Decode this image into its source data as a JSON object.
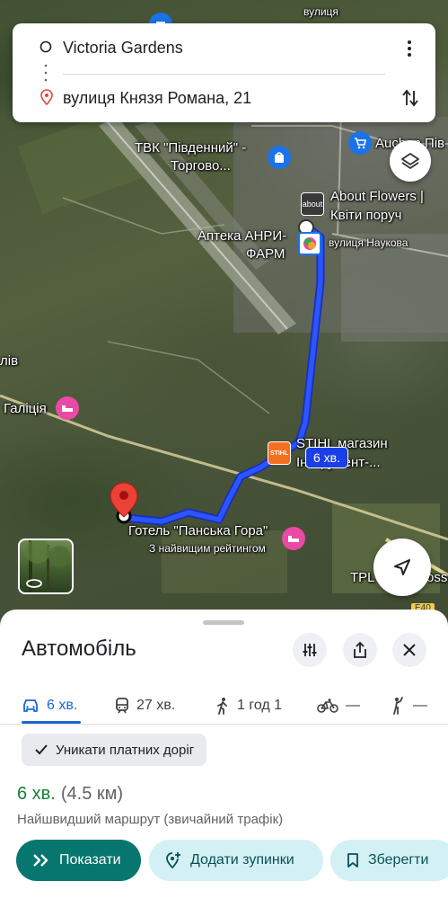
{
  "directions": {
    "origin": "Victoria Gardens",
    "destination": "вулиця Князя Романа, 21"
  },
  "map": {
    "labels": {
      "tvk": "ТВК \"Південний\" -",
      "tvk2": "Торгово...",
      "auchan": "Auchan Пів",
      "about_flowers": "About Flowers |",
      "about_flowers2": "Квіти поруч",
      "pharmacy": "Аптека АНРИ-",
      "pharmacy2": "ФАРМ",
      "street_naukova": "вулиця Наукова",
      "lviv": "лів",
      "galicia": "Галіція",
      "stihl": "STIHL магазин",
      "stihl2": "Інструмент-...",
      "hotel": "Готель \"Панська Гора\"",
      "hotel_rating": "З найвищим рейтингом",
      "tpl": "TPL",
      "ross": "oss",
      "top_label": "вулиця",
      "road_e40": "E40"
    },
    "route_time": "6 хв."
  },
  "sheet": {
    "title": "Автомобіль",
    "tabs": [
      {
        "label": "6 хв."
      },
      {
        "label": "27 хв."
      },
      {
        "label": "1 год 1"
      },
      {
        "label": "—"
      },
      {
        "label": "—"
      }
    ],
    "chip": "Уникати платних доріг",
    "eta_time": "6 хв.",
    "eta_distance": "(4.5 км)",
    "route_description": "Найшвидший маршрут (звичайний трафік)",
    "buttons": {
      "show": "Показати",
      "add_stops": "Додати зупинки",
      "save": "Зберегти"
    }
  },
  "colors": {
    "route": "#1a3fe8",
    "accent": "#1967d2",
    "primary_button": "#07766f",
    "eta_green": "#188038"
  }
}
